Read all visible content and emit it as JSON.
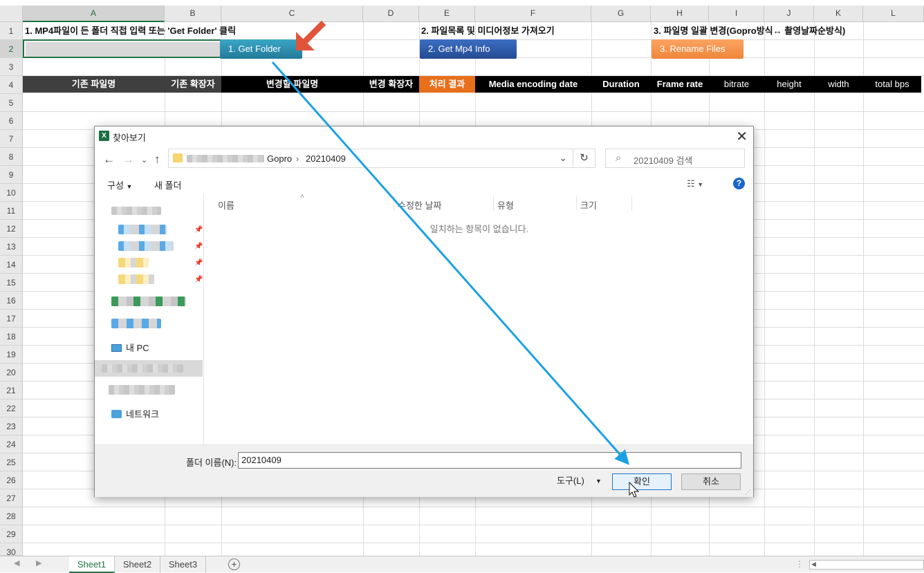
{
  "spreadsheet": {
    "columns": [
      "A",
      "B",
      "C",
      "D",
      "E",
      "F",
      "G",
      "H",
      "I",
      "J",
      "K",
      "L"
    ],
    "rows": [
      "1",
      "2",
      "3",
      "4",
      "5",
      "6",
      "7",
      "8",
      "9",
      "10",
      "11",
      "12",
      "13",
      "14",
      "15",
      "16",
      "17",
      "18",
      "19",
      "20",
      "21",
      "22",
      "23",
      "24",
      "25",
      "26",
      "27",
      "28",
      "29",
      "30"
    ],
    "titles": {
      "step1": "1. MP4파일이 든 폴더 직접 입력 또는 'Get Folder' 클릭",
      "step2": "2. 파일목록 및 미디어정보 가져오기",
      "step3": "3. 파일명 일괄 변경(Gopro방식↔ 촬영날짜순방식)"
    },
    "buttons": {
      "get_folder": "1. Get Folder",
      "get_mp4_info": "2. Get Mp4 Info",
      "rename_files": "3. Rename Files"
    },
    "header_row": [
      "기존 파일명",
      "기존 확장자",
      "변경할 파일명",
      "변경 확장자",
      "처리 결과",
      "Media encoding date",
      "Duration",
      "Frame rate",
      "bitrate",
      "height",
      "width",
      "total bps"
    ],
    "colors": {
      "get_folder_btn": "#2b8fb0",
      "get_mp4_btn": "#2f58a8",
      "rename_btn": "#f5954a",
      "result_header": "#e86f1c",
      "arrow_orange": "#e0553a",
      "arrow_blue": "#1ba1e2"
    }
  },
  "dialog": {
    "title": "찾아보기",
    "breadcrumb": [
      "Gopro",
      "20210409"
    ],
    "search_placeholder": "20210409 검색",
    "toolbar": {
      "organize": "구성",
      "new_folder": "새 폴더"
    },
    "nav": {
      "this_pc": "내 PC",
      "network": "네트워크"
    },
    "columns": {
      "name": "이름",
      "modified": "수정한 날짜",
      "type": "유형",
      "size": "크기"
    },
    "empty_message": "일치하는 항목이 없습니다.",
    "folder_label": "폴더 이름(N):",
    "folder_value": "20210409",
    "tools_label": "도구(L)",
    "ok_label": "확인",
    "cancel_label": "취소"
  },
  "sheet_tabs": [
    "Sheet1",
    "Sheet2",
    "Sheet3"
  ],
  "active_tab": "Sheet1"
}
